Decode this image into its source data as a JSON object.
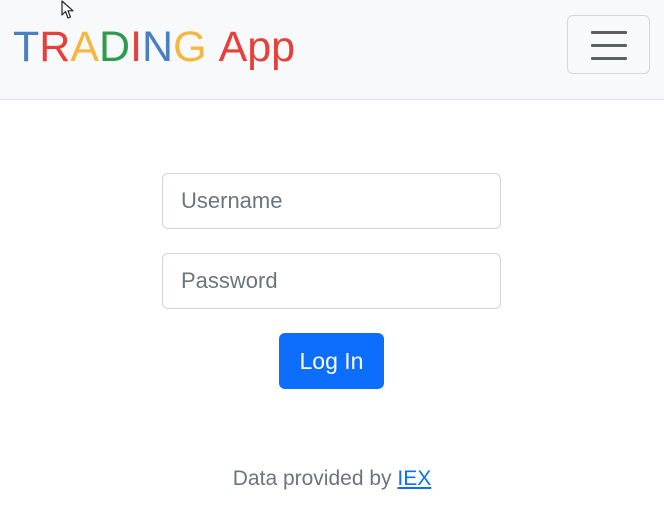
{
  "navbar": {
    "brand_letters": [
      {
        "char": "T",
        "color": "#4b7fc4"
      },
      {
        "char": "R",
        "color": "#e5403a"
      },
      {
        "char": "A",
        "color": "#f6b740"
      },
      {
        "char": "D",
        "color": "#2e9b4e"
      },
      {
        "char": "I",
        "color": "#e5403a"
      },
      {
        "char": "N",
        "color": "#4b7fc4"
      },
      {
        "char": "G",
        "color": "#f6b740"
      }
    ],
    "brand_suffix": "App",
    "brand_suffix_color": "#e5403a",
    "menu_icon": "hamburger-icon"
  },
  "login_form": {
    "username_placeholder": "Username",
    "username_value": "",
    "password_placeholder": "Password",
    "password_value": "",
    "submit_label": "Log In",
    "submit_color": "#0d6efd"
  },
  "footer": {
    "text": "Data provided by",
    "link_label": "IEX"
  }
}
